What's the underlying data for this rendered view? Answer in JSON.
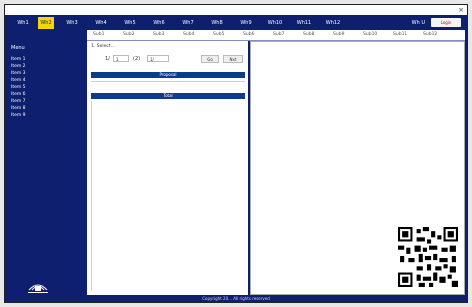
{
  "window": {
    "close_label": "×"
  },
  "menubar": {
    "items": [
      {
        "label": "Wh1"
      },
      {
        "label": "Wh2"
      },
      {
        "label": "Wh3"
      },
      {
        "label": "Wh4"
      },
      {
        "label": "Wh5"
      },
      {
        "label": "Wh6"
      },
      {
        "label": "Wh7"
      },
      {
        "label": "Wh8"
      },
      {
        "label": "Wh9"
      },
      {
        "label": "Wh10"
      },
      {
        "label": "Wh11"
      },
      {
        "label": "Wh12"
      }
    ],
    "user_label": "Wh U",
    "login_label": "Login"
  },
  "submenu": {
    "items": [
      {
        "label": "Sub1"
      },
      {
        "label": "Sub2"
      },
      {
        "label": "Sub3"
      },
      {
        "label": "Sub4"
      },
      {
        "label": "Sub5"
      },
      {
        "label": "Sub6"
      },
      {
        "label": "Sub7"
      },
      {
        "label": "Sub8"
      },
      {
        "label": "Sub9"
      },
      {
        "label": "Sub10"
      },
      {
        "label": "Sub11"
      },
      {
        "label": "Sub12"
      }
    ]
  },
  "sidebar": {
    "title": "Menu",
    "items": [
      {
        "label": "Item 1"
      },
      {
        "label": "Item 2"
      },
      {
        "label": "Item 3"
      },
      {
        "label": "Item 4"
      },
      {
        "label": "Item 5"
      },
      {
        "label": "Item 6"
      },
      {
        "label": "Item 7"
      },
      {
        "label": "Item 8"
      },
      {
        "label": "Item 9"
      }
    ]
  },
  "content": {
    "field_label": "1. Select...",
    "pager": {
      "prefix": "1/",
      "page_value": "1",
      "middle": "(2)",
      "size_value": "1/",
      "go_label": "Go",
      "next_label": "Nxt"
    },
    "bar1_label": "Proposal",
    "bar2_label": "Total"
  },
  "footer": {
    "text": "Copyright 20... All rights reserved"
  }
}
